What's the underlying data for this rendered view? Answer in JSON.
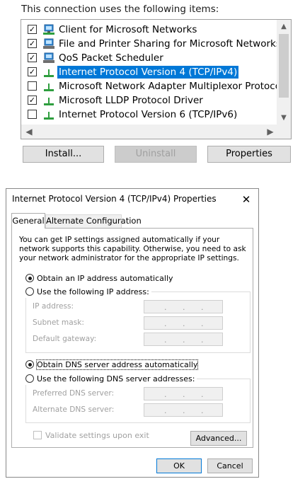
{
  "top_panel": {
    "heading": "This connection uses the following items:",
    "items": [
      {
        "label": "Client for Microsoft Networks",
        "checked": true,
        "icon": "network-client-icon"
      },
      {
        "label": "File and Printer Sharing for Microsoft Networks",
        "checked": true,
        "icon": "network-service-icon"
      },
      {
        "label": "QoS Packet Scheduler",
        "checked": true,
        "icon": "network-service-icon"
      },
      {
        "label": "Internet Protocol Version 4 (TCP/IPv4)",
        "checked": true,
        "icon": "protocol-icon",
        "selected": true
      },
      {
        "label": "Microsoft Network Adapter Multiplexor Protocol",
        "checked": false,
        "icon": "protocol-icon"
      },
      {
        "label": "Microsoft LLDP Protocol Driver",
        "checked": true,
        "icon": "protocol-icon"
      },
      {
        "label": "Internet Protocol Version 6 (TCP/IPv6)",
        "checked": false,
        "icon": "protocol-icon"
      }
    ],
    "buttons": {
      "install": "Install...",
      "uninstall": "Uninstall",
      "properties": "Properties"
    }
  },
  "dialog": {
    "title": "Internet Protocol Version 4 (TCP/IPv4) Properties",
    "close_glyph": "✕",
    "tabs": {
      "general": "General",
      "alternate": "Alternate Configuration"
    },
    "description": "You can get IP settings assigned automatically if your network supports this capability. Otherwise, you need to ask your network administrator for the appropriate IP settings.",
    "ip": {
      "auto_label": "Obtain an IP address automatically",
      "manual_label": "Use the following IP address:",
      "fields": {
        "ip_address": "IP address:",
        "subnet_mask": "Subnet mask:",
        "default_gateway": "Default gateway:"
      }
    },
    "dns": {
      "auto_label": "Obtain DNS server address automatically",
      "manual_label": "Use the following DNS server addresses:",
      "fields": {
        "preferred": "Preferred DNS server:",
        "alternate": "Alternate DNS server:"
      }
    },
    "ip_separator": ".",
    "validate_label": "Validate settings upon exit",
    "advanced_button": "Advanced...",
    "ok_button": "OK",
    "cancel_button": "Cancel"
  },
  "colors": {
    "selection": "#0078d7",
    "disabled_text": "#a0a0a0",
    "button_face": "#e1e1e1"
  }
}
